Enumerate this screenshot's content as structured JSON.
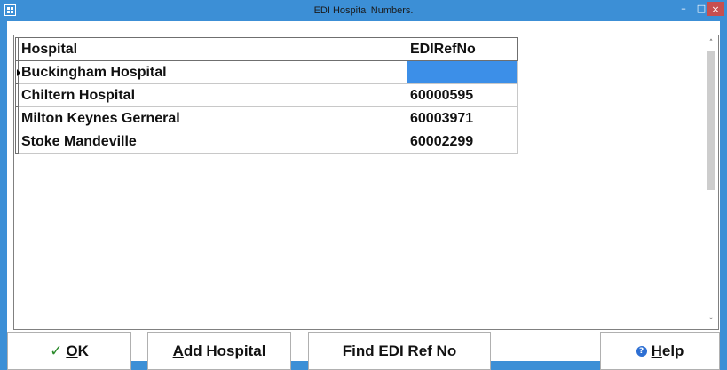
{
  "window": {
    "title": "EDI Hospital Numbers.",
    "controls": {
      "minimize": "–",
      "maximize": "□",
      "close": "×"
    }
  },
  "grid": {
    "columns": [
      "Hospital",
      "EDIRefNo"
    ],
    "rows": [
      {
        "hospital": "Buckingham Hospital",
        "edi": ""
      },
      {
        "hospital": "Chiltern Hospital",
        "edi": "60000595"
      },
      {
        "hospital": "Milton Keynes Gerneral",
        "edi": "60003971"
      },
      {
        "hospital": "Stoke Mandeville",
        "edi": "60002299"
      }
    ],
    "current_row_index": 0,
    "selected_cell_color": "#3c8fe8"
  },
  "scrollbar": {
    "up": "˄",
    "down": "˅"
  },
  "buttons": {
    "ok": {
      "icon": "checkmark-icon",
      "mnemonic": "O",
      "rest": "K"
    },
    "add_hospital": {
      "mnemonic": "A",
      "rest": "dd Hospital"
    },
    "find_edi": {
      "label": "Find EDI Ref No"
    },
    "help": {
      "icon": "help-circle-icon",
      "mnemonic": "H",
      "rest": "elp"
    }
  },
  "colors": {
    "accent": "#3c8fd6",
    "close_button": "#c74f4f"
  }
}
